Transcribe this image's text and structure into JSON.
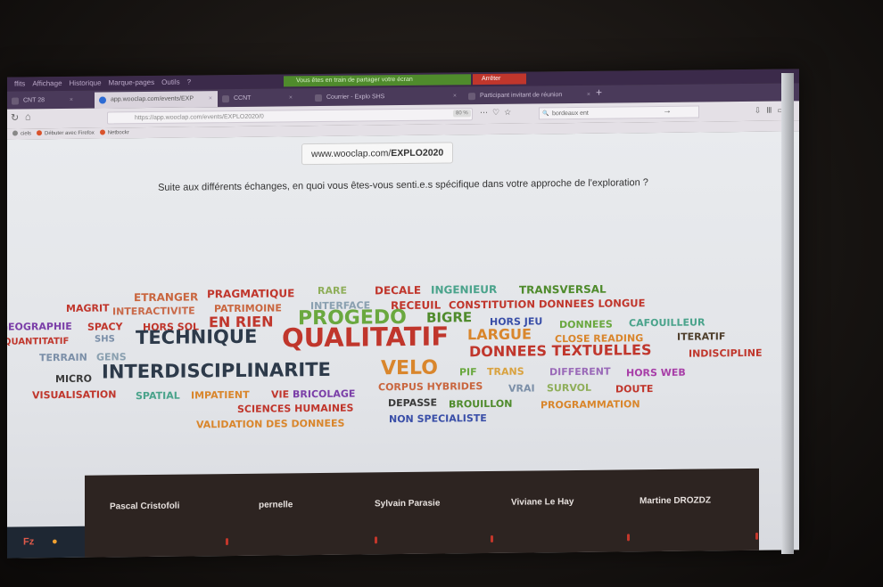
{
  "browser": {
    "menu_items": [
      "ffits",
      "Affichage",
      "Historique",
      "Marque-pages",
      "Outils",
      "?"
    ],
    "share_banner": "Vous êtes en train de partager votre écran",
    "stop_button": "Arrêter",
    "tabs": [
      {
        "label": "CNT 28",
        "active": false
      },
      {
        "label": "app.wooclap.com/events/EXP",
        "active": true
      },
      {
        "label": "CCNT",
        "active": false
      },
      {
        "label": "Courrier - Explo SHS",
        "active": false
      },
      {
        "label": "Participant invitant de réunion",
        "active": false
      }
    ],
    "url": "https://app.wooclap.com/events/EXPLO2020/0",
    "zoom": "80 %",
    "search_value": "bordeaux ent",
    "bookmarks": [
      {
        "label": "ciels",
        "color": "#888888"
      },
      {
        "label": "Débuter avec Firefox",
        "color": "#d9532c"
      },
      {
        "label": "Netbockr",
        "color": "#d9532c"
      }
    ]
  },
  "page": {
    "join_url_plain": "www.wooclap.com/",
    "join_url_bold": "EXPLO2020",
    "question": "Suite aux différents échanges, en quoi vous êtes-vous senti.e.s spécifique dans votre approche de l'exploration ?"
  },
  "word_cloud": [
    {
      "text": "ETRANGER",
      "color": "#c9663f"
    },
    {
      "text": "PRAGMATIQUE",
      "color": "#c0362c"
    },
    {
      "text": "RARE",
      "color": "#8fae5a"
    },
    {
      "text": "DECALE",
      "color": "#c0362c"
    },
    {
      "text": "INGENIEUR",
      "color": "#4aa38b"
    },
    {
      "text": "TRANSVERSAL",
      "color": "#4f8b2c"
    },
    {
      "text": "MAGRIT",
      "color": "#c0362c"
    },
    {
      "text": "INTERACTIVITE",
      "color": "#c96a4a"
    },
    {
      "text": "PATRIMOINE",
      "color": "#c9663f"
    },
    {
      "text": "INTERFACE",
      "color": "#8aa0b0"
    },
    {
      "text": "RECEUIL",
      "color": "#c0362c"
    },
    {
      "text": "CONSTITUTION DONNEES LONGUE",
      "color": "#c0362c"
    },
    {
      "text": "GEOGRAPHIE",
      "color": "#7b3fa8"
    },
    {
      "text": "SPACY",
      "color": "#c0362c"
    },
    {
      "text": "HORS SOL",
      "color": "#c0362c"
    },
    {
      "text": "EN RIEN",
      "color": "#c0362c"
    },
    {
      "text": "PROGEDO",
      "color": "#6aa83f"
    },
    {
      "text": "BIGRE",
      "color": "#4f8b2c"
    },
    {
      "text": "HORS JEU",
      "color": "#3a4fa8"
    },
    {
      "text": "DONNEES",
      "color": "#6aa83f"
    },
    {
      "text": "CAFOUILLEUR",
      "color": "#4aa38b"
    },
    {
      "text": "QUANTITATIF",
      "color": "#c0362c"
    },
    {
      "text": "SHS",
      "color": "#7b8fa8"
    },
    {
      "text": "TECHNIQUE",
      "color": "#2d3a4a"
    },
    {
      "text": "QUALITATIF",
      "color": "#c0362c"
    },
    {
      "text": "LARGUE",
      "color": "#d9862c"
    },
    {
      "text": "CLOSE READING",
      "color": "#d9862c"
    },
    {
      "text": "ITERATIF",
      "color": "#4f3f2c"
    },
    {
      "text": "TERRAIN",
      "color": "#7b8fa8"
    },
    {
      "text": "GENS",
      "color": "#8aa0b0"
    },
    {
      "text": "DONNEES TEXTUELLES",
      "color": "#c0362c"
    },
    {
      "text": "INDISCIPLINE",
      "color": "#c0362c"
    },
    {
      "text": "MICRO",
      "color": "#3a3a3a"
    },
    {
      "text": "INTERDISCIPLINARITE",
      "color": "#2d3a4a"
    },
    {
      "text": "VELO",
      "color": "#d9862c"
    },
    {
      "text": "PIF",
      "color": "#6aa83f"
    },
    {
      "text": "TRANS",
      "color": "#d9a23f"
    },
    {
      "text": "DIFFERENT",
      "color": "#9a6ab8"
    },
    {
      "text": "HORS WEB",
      "color": "#a83fa8"
    },
    {
      "text": "VISUALISATION",
      "color": "#c0362c"
    },
    {
      "text": "SPATIAL",
      "color": "#4aa38b"
    },
    {
      "text": "IMPATIENT",
      "color": "#d9862c"
    },
    {
      "text": "VIE",
      "color": "#c0362c"
    },
    {
      "text": "BRICOLAGE",
      "color": "#7b3fa8"
    },
    {
      "text": "CORPUS HYBRIDES",
      "color": "#c9663f"
    },
    {
      "text": "VRAI",
      "color": "#7b8fa8"
    },
    {
      "text": "SURVOL",
      "color": "#8fae5a"
    },
    {
      "text": "DOUTE",
      "color": "#c0362c"
    },
    {
      "text": "SCIENCES HUMAINES",
      "color": "#c0362c"
    },
    {
      "text": "DEPASSE",
      "color": "#3a3a3a"
    },
    {
      "text": "BROUILLON",
      "color": "#4f8b2c"
    },
    {
      "text": "PROGRAMMATION",
      "color": "#d9862c"
    },
    {
      "text": "VALIDATION DES DONNEES",
      "color": "#d9862c"
    },
    {
      "text": "NON SPECIALISTE",
      "color": "#3a4fa8"
    }
  ],
  "participants": [
    "Pascal Cristofoli",
    "pernelle",
    "Sylvain Parasie",
    "Viviane Le Hay",
    "Martine DROZDZ"
  ]
}
